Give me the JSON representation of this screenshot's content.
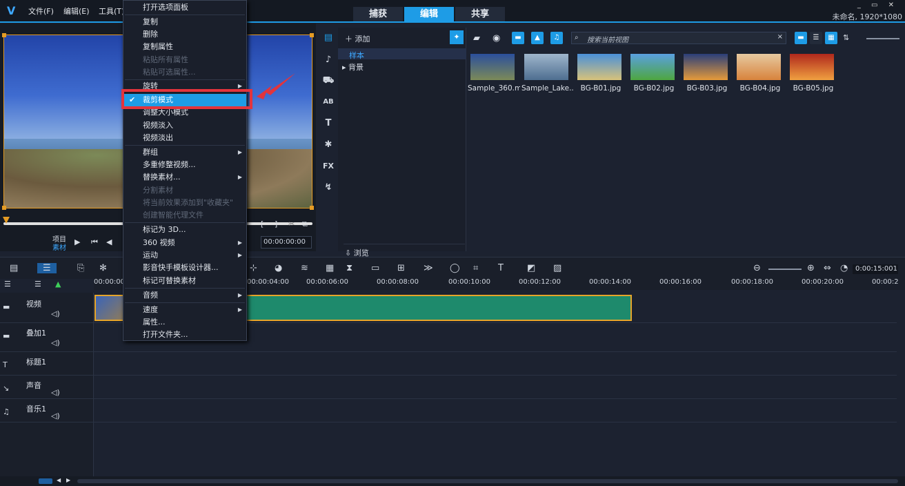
{
  "app": {
    "logo": "V",
    "menus": [
      "文件(F)",
      "编辑(E)",
      "工具(T)"
    ],
    "mode_tabs": [
      "捕获",
      "编辑",
      "共享"
    ],
    "active_mode": "编辑",
    "project_info": "未命名, 1920*1080",
    "window_buttons": "_ ▭ ✕"
  },
  "preview": {
    "label_project": "项目",
    "label_clip": "素材",
    "timecode": "00:00:00:00",
    "play_icon": "play-icon",
    "marks": [
      "[",
      "]"
    ]
  },
  "context_menu": {
    "items": [
      {
        "label": "打开选项面板",
        "disabled": false
      },
      {
        "label": "复制",
        "disabled": false
      },
      {
        "label": "删除",
        "disabled": false
      },
      {
        "label": "复制属性",
        "disabled": false
      },
      {
        "label": "粘贴所有属性",
        "disabled": true
      },
      {
        "label": "粘贴可选属性...",
        "disabled": true
      },
      {
        "label": "旋转",
        "disabled": false,
        "submenu": true
      },
      {
        "label": "裁剪模式",
        "disabled": false,
        "checked": true,
        "highlighted": true
      },
      {
        "label": "调整大小模式",
        "disabled": false
      },
      {
        "label": "视频淡入",
        "disabled": false
      },
      {
        "label": "视频淡出",
        "disabled": false
      },
      {
        "label": "群组",
        "disabled": false,
        "submenu": true
      },
      {
        "label": "多重修整视频...",
        "disabled": false
      },
      {
        "label": "替换素材...",
        "disabled": false,
        "submenu": true
      },
      {
        "label": "分割素材",
        "disabled": true
      },
      {
        "label": "将当前效果添加到\"收藏夹\"",
        "disabled": true
      },
      {
        "label": "创建智能代理文件",
        "disabled": true
      },
      {
        "label": "标记为 3D...",
        "disabled": false
      },
      {
        "label": "360 视频",
        "disabled": false,
        "submenu": true
      },
      {
        "label": "运动",
        "disabled": false,
        "submenu": true
      },
      {
        "label": "影音快手模板设计器...",
        "disabled": false
      },
      {
        "label": "标记可替换素材",
        "disabled": false
      },
      {
        "label": "音频",
        "disabled": false,
        "submenu": true
      },
      {
        "label": "速度",
        "disabled": false,
        "submenu": true
      },
      {
        "label": "属性...",
        "disabled": false
      },
      {
        "label": "打开文件夹...",
        "disabled": false
      }
    ]
  },
  "library": {
    "add_label": "添加",
    "folders": [
      "样本",
      "背景"
    ],
    "selected_folder": "样本",
    "search_placeholder": "搜索当前视图",
    "browse_label": "浏览",
    "tool_labels": [
      "AB",
      "T",
      "FX"
    ],
    "thumbnails": [
      {
        "label": "Sample_360.m...",
        "colors": [
          "#2b4f9c",
          "#7c8a58"
        ]
      },
      {
        "label": "Sample_Lake....",
        "colors": [
          "#9fb6cc",
          "#4e6e90"
        ]
      },
      {
        "label": "BG-B01.jpg",
        "colors": [
          "#4a90d8",
          "#d8c27a"
        ]
      },
      {
        "label": "BG-B02.jpg",
        "colors": [
          "#5aa0e0",
          "#4ea640"
        ]
      },
      {
        "label": "BG-B03.jpg",
        "colors": [
          "#2a3f7a",
          "#e59a3a"
        ]
      },
      {
        "label": "BG-B04.jpg",
        "colors": [
          "#e6c9a0",
          "#d8833c"
        ]
      },
      {
        "label": "BG-B05.jpg",
        "colors": [
          "#b0281c",
          "#f0a040"
        ]
      }
    ]
  },
  "timeline": {
    "timecode": "0:00:15:001",
    "ticks": [
      "00:00:00:00",
      "00:00:04:00",
      "00:00:06:00",
      "00:00:08:00",
      "00:00:10:00",
      "00:00:12:00",
      "00:00:14:00",
      "00:00:16:00",
      "00:00:18:00",
      "00:00:20:00",
      "00:00:2"
    ],
    "tracks": [
      {
        "name": "视频",
        "icon": "video-track-icon"
      },
      {
        "name": "叠加1",
        "icon": "overlay-track-icon"
      },
      {
        "name": "标题1",
        "icon": "title-track-icon"
      },
      {
        "name": "声音",
        "icon": "voice-track-icon"
      },
      {
        "name": "音乐1",
        "icon": "music-track-icon"
      }
    ]
  }
}
